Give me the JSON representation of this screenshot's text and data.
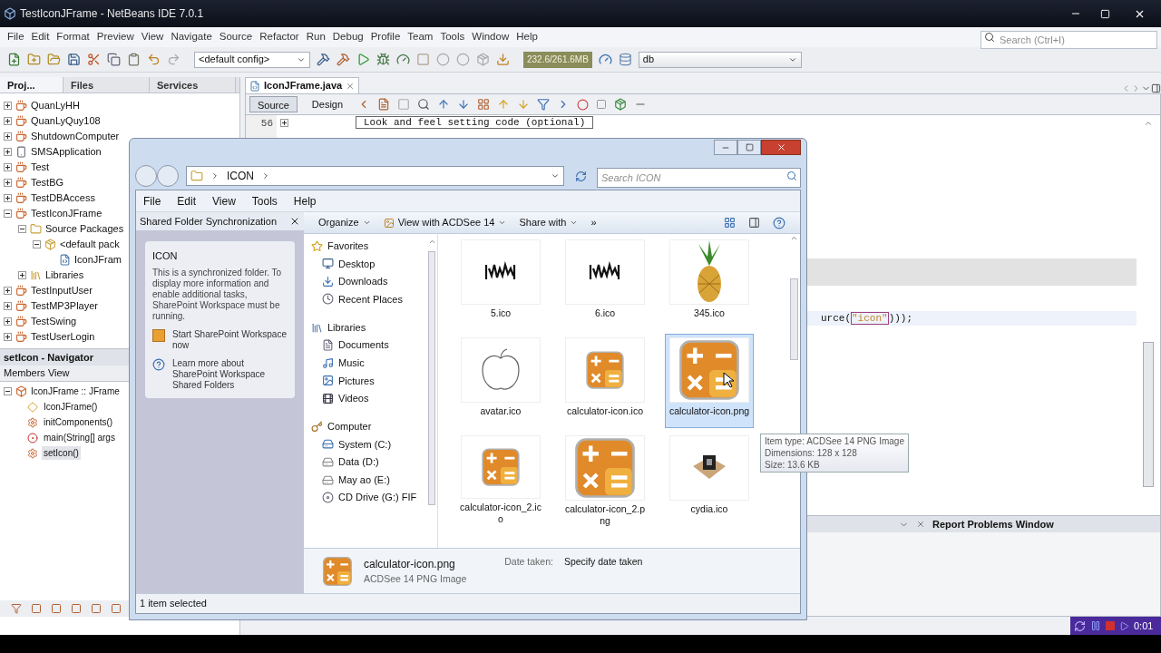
{
  "window": {
    "title": "TestIconJFrame - NetBeans IDE 7.0.1"
  },
  "menu": [
    "File",
    "Edit",
    "Format",
    "Preview",
    "View",
    "Navigate",
    "Source",
    "Refactor",
    "Run",
    "Debug",
    "Profile",
    "Team",
    "Tools",
    "Window",
    "Help"
  ],
  "search": {
    "placeholder": "Search (Ctrl+I)"
  },
  "toolbar": {
    "config": "<default config>",
    "memory": "232.6/261.6MB",
    "profile": "db"
  },
  "projects_panel": {
    "tabs": [
      {
        "label": "Proj...",
        "selected": true
      },
      {
        "label": "Files",
        "selected": false
      },
      {
        "label": "Services",
        "selected": false
      }
    ],
    "tree": [
      {
        "label": "QuanLyHH",
        "kind": "project",
        "expanded": false
      },
      {
        "label": "QuanLyQuy108",
        "kind": "project",
        "expanded": false
      },
      {
        "label": "ShutdownComputer",
        "kind": "project",
        "expanded": false
      },
      {
        "label": "SMSApplication",
        "kind": "phone-project",
        "expanded": false
      },
      {
        "label": "Test",
        "kind": "project",
        "expanded": false
      },
      {
        "label": "TestBG",
        "kind": "project",
        "expanded": false
      },
      {
        "label": "TestDBAccess",
        "kind": "project",
        "expanded": false
      },
      {
        "label": "TestIconJFrame",
        "kind": "project",
        "expanded": true,
        "children": [
          {
            "label": "Source Packages",
            "kind": "source-folder",
            "expanded": true,
            "children": [
              {
                "label": "<default pack",
                "kind": "package",
                "expanded": true,
                "children": [
                  {
                    "label": "IconJFram",
                    "kind": "java-file"
                  }
                ]
              }
            ]
          },
          {
            "label": "Libraries",
            "kind": "library-folder",
            "expanded": false
          }
        ]
      },
      {
        "label": "TestInputUser",
        "kind": "project",
        "expanded": false
      },
      {
        "label": "TestMP3Player",
        "kind": "project",
        "expanded": false
      },
      {
        "label": "TestSwing",
        "kind": "project",
        "expanded": false
      },
      {
        "label": "TestUserLogin",
        "kind": "project",
        "expanded": false
      }
    ]
  },
  "navigator": {
    "title": "setIcon - Navigator",
    "view": "Members View",
    "root": {
      "label": "IconJFrame :: JFrame",
      "expanded": true
    },
    "members": [
      {
        "label": "IconJFrame()",
        "kind": "constructor",
        "selected": false
      },
      {
        "label": "initComponents()",
        "kind": "method",
        "selected": false
      },
      {
        "label": "main(String[] args",
        "kind": "static-method",
        "selected": false
      },
      {
        "label": "setIcon()",
        "kind": "method",
        "selected": true
      }
    ]
  },
  "editor": {
    "tab": "IconJFrame.java",
    "views": [
      {
        "label": "Source",
        "selected": true
      },
      {
        "label": "Design",
        "selected": false
      }
    ],
    "fold": {
      "line": "56",
      "text": "Look and feel setting code (optional)"
    },
    "code": {
      "before": "urce(",
      "string": "\"icon\"",
      "after": ")));"
    }
  },
  "bottom_panel": {
    "tab": "Report Problems Window"
  },
  "explorer": {
    "breadcrumb": "ICON",
    "search": {
      "placeholder": "Search ICON"
    },
    "menu": [
      "File",
      "Edit",
      "View",
      "Tools",
      "Help"
    ],
    "sync_pane": {
      "title": "Shared Folder Synchronization",
      "heading": "ICON",
      "text": "This is a synchronized folder. To display more information and enable additional tasks, SharePoint Workspace must be running.",
      "links": [
        {
          "label": "Start SharePoint Workspace now",
          "kind": "sharepoint"
        },
        {
          "label": "Learn more about SharePoint Workspace Shared Folders",
          "kind": "help"
        }
      ]
    },
    "commands": [
      {
        "label": "Organize",
        "kind": "menu"
      },
      {
        "label": "View with ACDSee 14",
        "kind": "app-menu"
      },
      {
        "label": "Share with",
        "kind": "menu"
      },
      {
        "label": "»",
        "kind": "more"
      }
    ],
    "nav": [
      {
        "label": "Favorites",
        "kind": "favorites",
        "children": [
          {
            "label": "Desktop",
            "kind": "desktop"
          },
          {
            "label": "Downloads",
            "kind": "downloads"
          },
          {
            "label": "Recent Places",
            "kind": "recent"
          }
        ]
      },
      {
        "label": "Libraries",
        "kind": "libraries",
        "children": [
          {
            "label": "Documents",
            "kind": "documents"
          },
          {
            "label": "Music",
            "kind": "music"
          },
          {
            "label": "Pictures",
            "kind": "pictures"
          },
          {
            "label": "Videos",
            "kind": "videos"
          }
        ]
      },
      {
        "label": "Computer",
        "kind": "computer",
        "children": [
          {
            "label": "System (C:)",
            "kind": "system-drive"
          },
          {
            "label": "Data (D:)",
            "kind": "drive"
          },
          {
            "label": "May ao (E:)",
            "kind": "drive"
          },
          {
            "label": "CD Drive (G:) FIF",
            "kind": "cd-drive"
          }
        ]
      }
    ],
    "files": [
      {
        "name": "5.ico",
        "kind": "glyphs",
        "selected": false
      },
      {
        "name": "6.ico",
        "kind": "glyphs",
        "selected": false
      },
      {
        "name": "345.ico",
        "kind": "pineapple",
        "selected": false
      },
      {
        "name": "avatar.ico",
        "kind": "apple",
        "selected": false
      },
      {
        "name": "calculator-icon.ico",
        "kind": "calculator-small",
        "selected": false
      },
      {
        "name": "calculator-icon.png",
        "kind": "calculator",
        "selected": true
      },
      {
        "name": "calculator-icon_2.ico",
        "kind": "calculator-small",
        "selected": false
      },
      {
        "name": "calculator-icon_2.png",
        "kind": "calculator",
        "selected": false
      },
      {
        "name": "cydia.ico",
        "kind": "box",
        "selected": false
      }
    ],
    "tooltip": [
      "Item type: ACDSee 14 PNG Image",
      "Dimensions: 128 x 128",
      "Size: 13.6 KB"
    ],
    "details": {
      "name": "calculator-icon.png",
      "type": "ACDSee 14 PNG Image",
      "field_label": "Date taken:",
      "field_value": "Specify date taken"
    },
    "status": "1 item selected"
  },
  "recorder": {
    "time": "0:01"
  }
}
